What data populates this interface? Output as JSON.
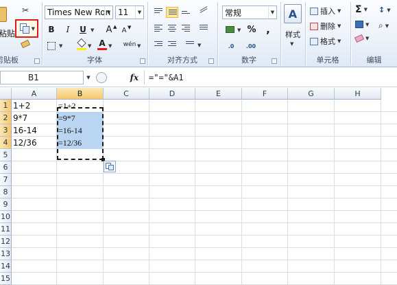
{
  "ribbon": {
    "clipboard": {
      "paste_label": "粘贴",
      "group_label": "剪贴板"
    },
    "font": {
      "font_name": "Times New Ron",
      "font_size": "11",
      "bold": "B",
      "italic": "I",
      "underline": "U",
      "grow": "A",
      "shrink": "A",
      "phonetic": "wén",
      "group_label": "字体"
    },
    "alignment": {
      "group_label": "对齐方式"
    },
    "number": {
      "format": "常规",
      "percent": "%",
      "comma": ",",
      "inc_decimal": ".0",
      "dec_decimal": ".00",
      "group_label": "数字"
    },
    "styles": {
      "label": "样式"
    },
    "cells": {
      "insert": "插入",
      "delete": "删除",
      "format": "格式",
      "group_label": "单元格"
    },
    "editing": {
      "sum": "Σ",
      "group_label": "编辑"
    }
  },
  "formula_bar": {
    "name_box": "B1",
    "fx": "fx",
    "formula": "=\"=\"&A1"
  },
  "sheet": {
    "columns": [
      "A",
      "B",
      "C",
      "D",
      "E",
      "F",
      "G",
      "H"
    ],
    "rows": [
      "1",
      "2",
      "3",
      "4",
      "5",
      "6",
      "7",
      "8",
      "9",
      "10",
      "11",
      "12",
      "13",
      "14",
      "15"
    ],
    "cells": [
      {
        "A": "1+2",
        "B": "=1+2"
      },
      {
        "A": "9*7",
        "B": "=9*7"
      },
      {
        "A": "16-14",
        "B": "=16-14"
      },
      {
        "A": "12/36",
        "B": "=12/36"
      }
    ]
  },
  "colors": {
    "selection_marquee": "#e01b1b",
    "selected_fill": "#b9d5f2",
    "header_active": "#f5c96f"
  }
}
